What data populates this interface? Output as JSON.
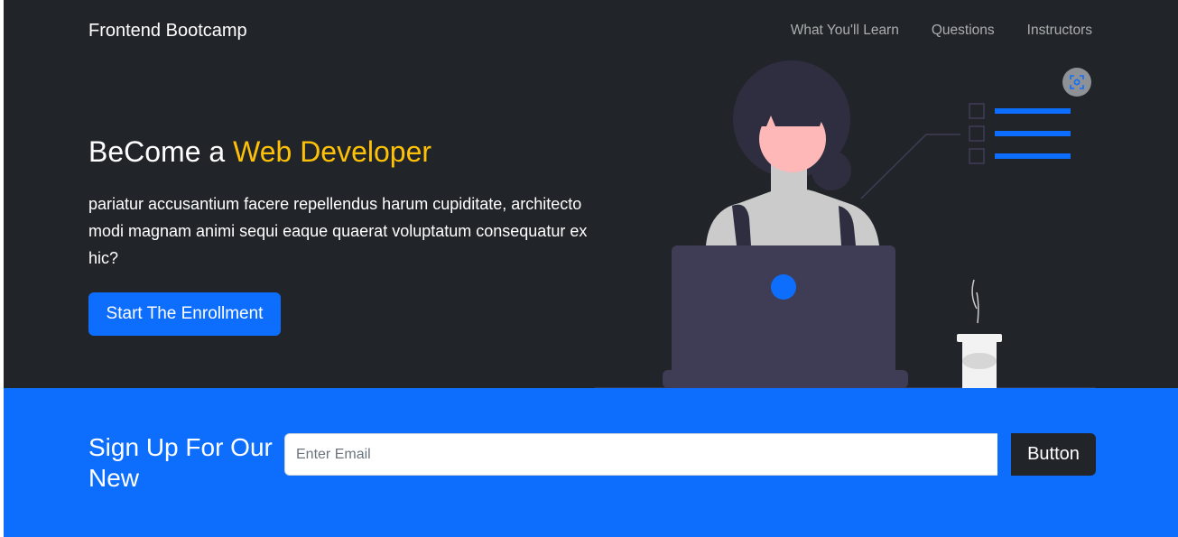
{
  "nav": {
    "brand": "Frontend Bootcamp",
    "links": [
      "What You'll Learn",
      "Questions",
      "Instructors"
    ]
  },
  "hero": {
    "title_prefix": "BeCome a ",
    "title_accent": "Web Developer",
    "text": "pariatur accusantium facere repellendus harum cupiditate, architecto modi magnam animi sequi eaque quaerat voluptatum consequatur ex hic?",
    "cta_label": "Start The Enrollment",
    "illustration_icon": "woman-at-laptop-illustration",
    "screenshot_icon": "screenshot-icon"
  },
  "signup": {
    "title": "Sign Up For Our New",
    "email_placeholder": "Enter Email",
    "button_label": "Button"
  },
  "colors": {
    "hero_bg": "#212529",
    "accent": "#ffc107",
    "primary": "#0d6efd"
  }
}
